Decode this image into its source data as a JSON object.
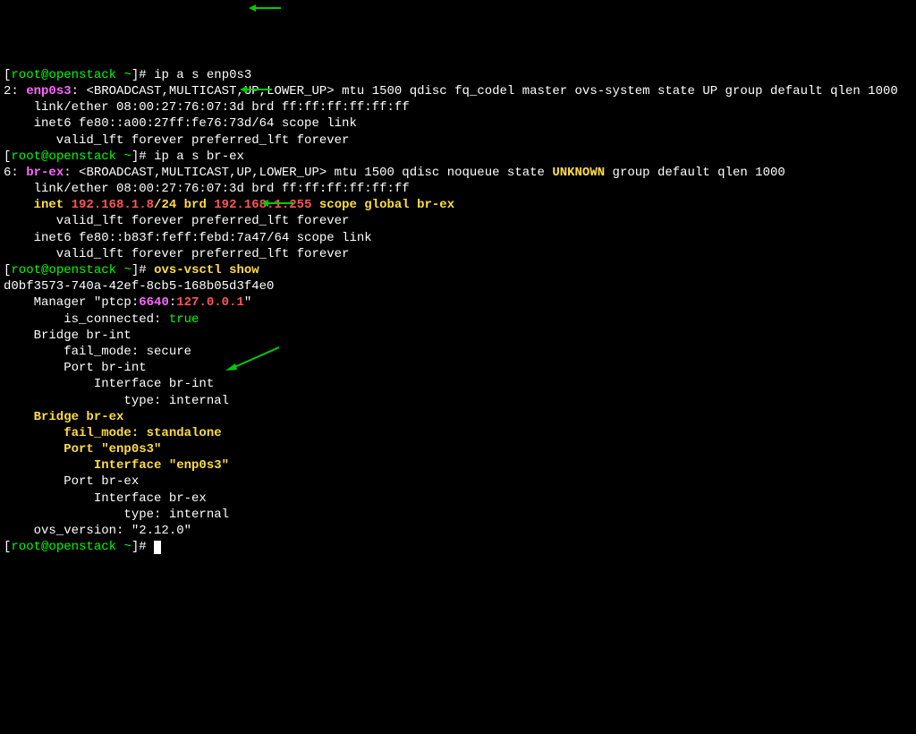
{
  "prompts": {
    "open": "[",
    "close": "]",
    "user": "root",
    "at": "@",
    "host": "openstack",
    "path": " ~",
    "symbol": "# "
  },
  "cmd1": "ip a s enp0s3",
  "out1": {
    "a": "2: ",
    "iface": "enp0s3",
    "b": ": <BROADCAST,MULTICAST,UP,LOWER_UP> mtu 1500 qdisc fq_codel master ovs-system state UP group default qlen 1000",
    "c": "    link/ether 08:00:27:76:07:3d brd ff:ff:ff:ff:ff:ff",
    "d": "    inet6 fe80::a00:27ff:fe76:73d/64 scope link",
    "e": "       valid_lft forever preferred_lft forever"
  },
  "cmd2": "ip a s br-ex",
  "out2": {
    "a": "6: ",
    "iface": "br-ex",
    "b": ": <BROADCAST,MULTICAST,UP,LOWER_UP> mtu 1500 qdisc noqueue state ",
    "unk": "UNKNOWN",
    "c": " group default qlen 1000",
    "d": "    link/ether 08:00:27:76:07:3d brd ff:ff:ff:ff:ff:ff",
    "inet_label": "    inet ",
    "inet_ip": "192.168.1.8",
    "inet_mask": "/24 brd ",
    "inet_brd": "192.168.1.255",
    "inet_rest": " scope global br-ex",
    "g": "       valid_lft forever preferred_lft forever",
    "h": "    inet6 fe80::b83f:feff:febd:7a47/64 scope link",
    "i": "       valid_lft forever preferred_lft forever"
  },
  "cmd3": "ovs-vsctl show",
  "out3": {
    "a": "d0bf3573-740a-42ef-8cb5-168b05d3f4e0",
    "b": "    Manager \"ptcp:",
    "b_port": "6640",
    "b_sep": ":",
    "b_ip": "127.0.0.1",
    "b_end": "\"",
    "c": "        is_connected: ",
    "c_val": "true",
    "d": "    Bridge br-int",
    "e": "        fail_mode: secure",
    "f": "        Port br-int",
    "g": "            Interface br-int",
    "h": "                type: internal",
    "i1": "    Bridge br-ex",
    "i2": "        fail_mode: standalone",
    "i3": "        Port \"enp0s3\"",
    "i4": "            Interface \"enp0s3\"",
    "j": "        Port br-ex",
    "k": "            Interface br-ex",
    "l": "                type: internal",
    "m": "    ovs_version: \"2.12.0\""
  }
}
